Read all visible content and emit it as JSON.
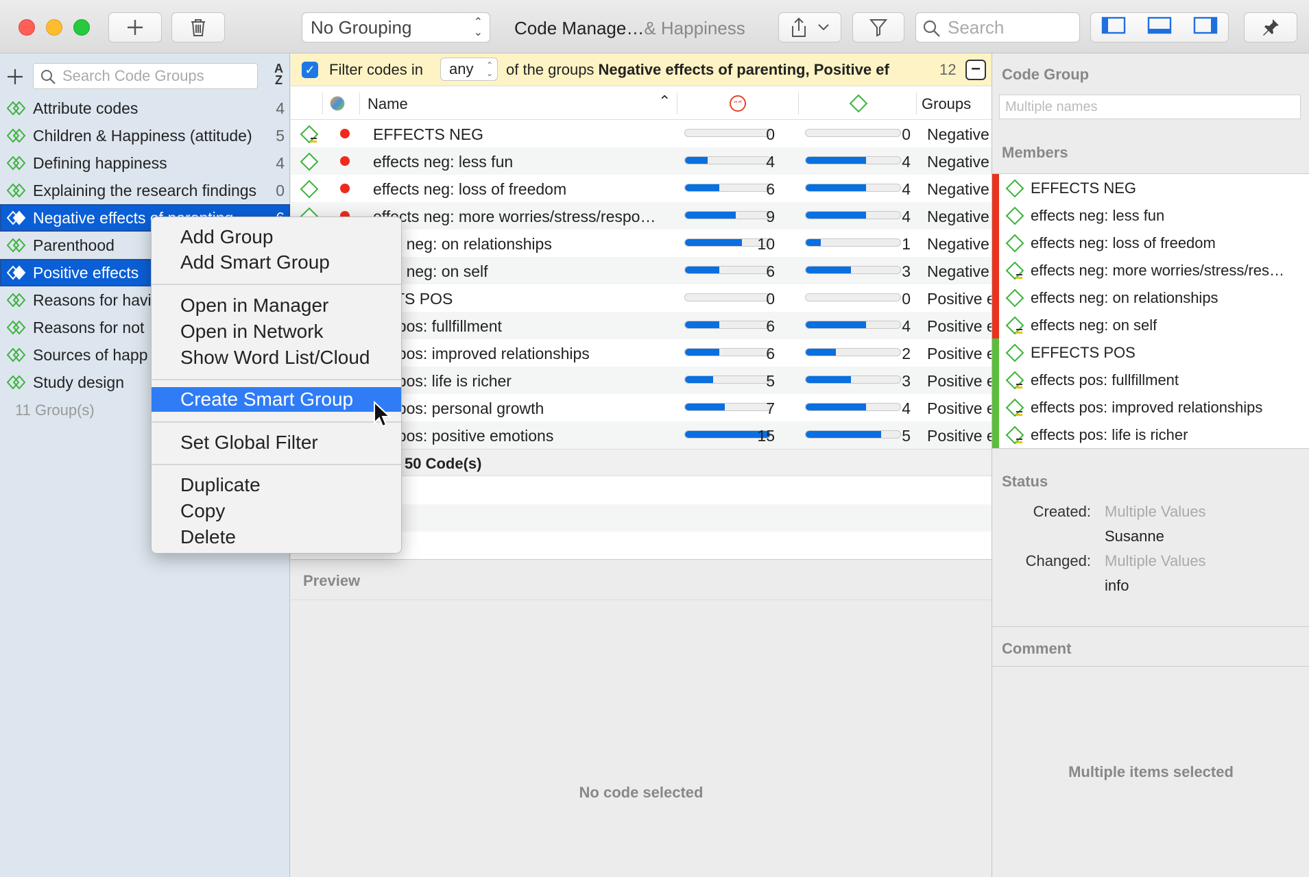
{
  "toolbar": {
    "grouping_select": "No Grouping",
    "title_main": "Code Manage…",
    "title_dim": "& Happiness",
    "search_placeholder": "Search"
  },
  "sidebar": {
    "search_placeholder": "Search Code Groups",
    "sort_label_top": "A",
    "sort_label_bottom": "Z",
    "items": [
      {
        "label": "Attribute codes",
        "count": "4"
      },
      {
        "label": "Children & Happiness (attitude)",
        "count": "5"
      },
      {
        "label": "Defining happiness",
        "count": "4"
      },
      {
        "label": "Explaining the research findings",
        "count": "0"
      },
      {
        "label": "Negative effects of parenting",
        "count": "6"
      },
      {
        "label": "Parenthood",
        "count": ""
      },
      {
        "label": "Positive effects",
        "count": ""
      },
      {
        "label": "Reasons for havi",
        "count": ""
      },
      {
        "label": "Reasons for not",
        "count": ""
      },
      {
        "label": "Sources of happ",
        "count": ""
      },
      {
        "label": "Study design",
        "count": ""
      }
    ],
    "footer": "11 Group(s)"
  },
  "filter": {
    "prefix": "Filter codes in",
    "mode": "any",
    "middle": "of the groups ",
    "groups": "Negative effects of parenting, Positive ef…",
    "count": "12"
  },
  "table": {
    "col_name": "Name",
    "col_groups": "Groups",
    "rows": [
      {
        "name": "EFFECTS NEG",
        "v1": 0,
        "v1_label": "0",
        "v2": 0,
        "v2_label": "0",
        "group": "Negative",
        "icon": "code-group-icon"
      },
      {
        "name": "effects neg: less fun",
        "v1": 4,
        "v1_label": "4",
        "v2": 4,
        "v2_label": "4",
        "group": "Negative",
        "icon": "code-icon"
      },
      {
        "name": "effects neg: loss of freedom",
        "v1": 6,
        "v1_label": "6",
        "v2": 4,
        "v2_label": "4",
        "group": "Negative",
        "icon": "code-icon"
      },
      {
        "name": "effects neg: more worries/stress/respo…",
        "v1": 9,
        "v1_label": "9",
        "v2": 4,
        "v2_label": "4",
        "group": "Negative",
        "icon": "code-icon"
      },
      {
        "name": "ects neg: on relationships",
        "v1": 10,
        "v1_label": "10",
        "v2": 1,
        "v2_label": "1",
        "group": "Negative",
        "icon": "code-icon"
      },
      {
        "name": "ects neg: on self",
        "v1": 6,
        "v1_label": "6",
        "v2": 3,
        "v2_label": "3",
        "group": "Negative",
        "icon": "code-icon"
      },
      {
        "name": "ECTS POS",
        "v1": 0,
        "v1_label": "0",
        "v2": 0,
        "v2_label": "0",
        "group": "Positive e",
        "icon": "code-icon"
      },
      {
        "name": "cts pos: fullfillment",
        "v1": 6,
        "v1_label": "6",
        "v2": 4,
        "v2_label": "4",
        "group": "Positive e",
        "icon": "code-icon"
      },
      {
        "name": "cts pos: improved relationships",
        "v1": 6,
        "v1_label": "6",
        "v2": 2,
        "v2_label": "2",
        "group": "Positive e",
        "icon": "code-icon"
      },
      {
        "name": "cts pos: life is richer",
        "v1": 5,
        "v1_label": "5",
        "v2": 3,
        "v2_label": "3",
        "group": "Positive e",
        "icon": "code-icon"
      },
      {
        "name": "cts pos: personal growth",
        "v1": 7,
        "v1_label": "7",
        "v2": 4,
        "v2_label": "4",
        "group": "Positive e",
        "icon": "code-icon"
      },
      {
        "name": "cts pos: positive emotions",
        "v1": 15,
        "v1_label": "15",
        "v2": 5,
        "v2_label": "5",
        "group": "Positive e",
        "icon": "code-icon"
      }
    ],
    "v1_max": 15,
    "v2_max": 5,
    "footer": "50 Code(s)"
  },
  "preview": {
    "title": "Preview",
    "empty": "No code selected"
  },
  "inspector": {
    "code_group_label": "Code Group",
    "name_placeholder": "Multiple names",
    "members_label": "Members",
    "members": [
      {
        "name": "EFFECTS NEG",
        "side": "neg"
      },
      {
        "name": "effects neg: less fun",
        "side": "neg"
      },
      {
        "name": "effects neg: loss of freedom",
        "side": "neg"
      },
      {
        "name": "effects neg: more worries/stress/res…",
        "side": "neg"
      },
      {
        "name": "effects neg: on relationships",
        "side": "neg"
      },
      {
        "name": "effects neg: on self",
        "side": "neg"
      },
      {
        "name": "EFFECTS POS",
        "side": "pos"
      },
      {
        "name": "effects pos: fullfillment",
        "side": "pos"
      },
      {
        "name": "effects pos: improved relationships",
        "side": "pos"
      },
      {
        "name": "effects pos: life is richer",
        "side": "pos"
      }
    ],
    "status_label": "Status",
    "created_key": "Created:",
    "created_val": "Multiple Values",
    "created_by": "Susanne",
    "changed_key": "Changed:",
    "changed_val": "Multiple Values",
    "changed_by": "info",
    "comment_label": "Comment",
    "multiple_selected": "Multiple items selected"
  },
  "context_menu": {
    "add_group": "Add Group",
    "add_smart_group": "Add Smart Group",
    "open_manager": "Open in Manager",
    "open_network": "Open in Network",
    "word_list": "Show Word List/Cloud",
    "create_smart_group": "Create Smart Group",
    "set_global_filter": "Set Global Filter",
    "duplicate": "Duplicate",
    "copy": "Copy",
    "delete": "Delete"
  },
  "colors": {
    "selection": "#0a5fd6",
    "menu_highlight": "#2f7cf6",
    "bar_fill": "#0a6fe0",
    "neg_stripe": "#e8331f",
    "pos_stripe": "#5cbd3d",
    "code_icon": "#3db33d",
    "filter_bg": "#fdf3c4"
  }
}
